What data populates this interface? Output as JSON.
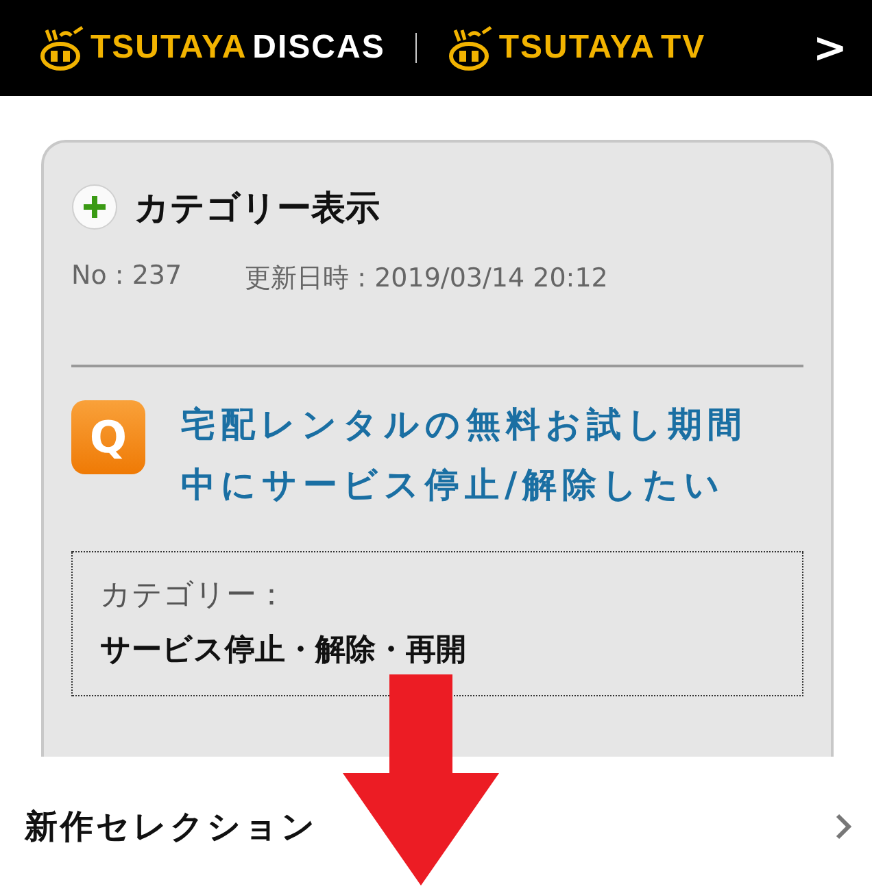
{
  "header": {
    "logos": [
      {
        "parts": [
          {
            "text": "TSUTAYA",
            "color": "#f2b300"
          },
          {
            "text": "DISCAS",
            "color": "#ffffff"
          }
        ]
      },
      {
        "parts": [
          {
            "text": "TSUTAYA",
            "color": "#f2b300"
          },
          {
            "text": "TV",
            "color": "#f2b300"
          }
        ]
      }
    ],
    "next": ">"
  },
  "faq": {
    "toggle_label": "カテゴリー表示",
    "expanded": false,
    "number": "No : 237",
    "updated": "更新日時 : 2019/03/14 20:12",
    "q_badge": "Q",
    "question": "宅配レンタルの無料お試し期間中にサービス停止/解除したい",
    "category_label": "カテゴリー：",
    "category": "サービス停止・解除・再開"
  },
  "section": {
    "title": "新作セレクション"
  }
}
